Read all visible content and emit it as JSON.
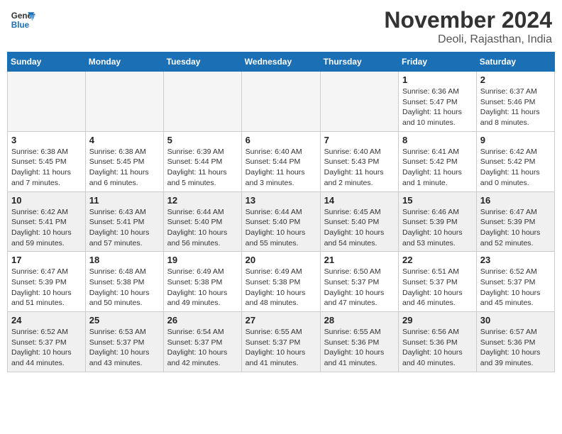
{
  "header": {
    "logo_line1": "General",
    "logo_line2": "Blue",
    "month": "November 2024",
    "location": "Deoli, Rajasthan, India"
  },
  "weekdays": [
    "Sunday",
    "Monday",
    "Tuesday",
    "Wednesday",
    "Thursday",
    "Friday",
    "Saturday"
  ],
  "weeks": [
    [
      {
        "day": "",
        "info": "",
        "empty": true
      },
      {
        "day": "",
        "info": "",
        "empty": true
      },
      {
        "day": "",
        "info": "",
        "empty": true
      },
      {
        "day": "",
        "info": "",
        "empty": true
      },
      {
        "day": "",
        "info": "",
        "empty": true
      },
      {
        "day": "1",
        "info": "Sunrise: 6:36 AM\nSunset: 5:47 PM\nDaylight: 11 hours and 10 minutes."
      },
      {
        "day": "2",
        "info": "Sunrise: 6:37 AM\nSunset: 5:46 PM\nDaylight: 11 hours and 8 minutes."
      }
    ],
    [
      {
        "day": "3",
        "info": "Sunrise: 6:38 AM\nSunset: 5:45 PM\nDaylight: 11 hours and 7 minutes."
      },
      {
        "day": "4",
        "info": "Sunrise: 6:38 AM\nSunset: 5:45 PM\nDaylight: 11 hours and 6 minutes."
      },
      {
        "day": "5",
        "info": "Sunrise: 6:39 AM\nSunset: 5:44 PM\nDaylight: 11 hours and 5 minutes."
      },
      {
        "day": "6",
        "info": "Sunrise: 6:40 AM\nSunset: 5:44 PM\nDaylight: 11 hours and 3 minutes."
      },
      {
        "day": "7",
        "info": "Sunrise: 6:40 AM\nSunset: 5:43 PM\nDaylight: 11 hours and 2 minutes."
      },
      {
        "day": "8",
        "info": "Sunrise: 6:41 AM\nSunset: 5:42 PM\nDaylight: 11 hours and 1 minute."
      },
      {
        "day": "9",
        "info": "Sunrise: 6:42 AM\nSunset: 5:42 PM\nDaylight: 11 hours and 0 minutes."
      }
    ],
    [
      {
        "day": "10",
        "info": "Sunrise: 6:42 AM\nSunset: 5:41 PM\nDaylight: 10 hours and 59 minutes.",
        "shaded": true
      },
      {
        "day": "11",
        "info": "Sunrise: 6:43 AM\nSunset: 5:41 PM\nDaylight: 10 hours and 57 minutes.",
        "shaded": true
      },
      {
        "day": "12",
        "info": "Sunrise: 6:44 AM\nSunset: 5:40 PM\nDaylight: 10 hours and 56 minutes.",
        "shaded": true
      },
      {
        "day": "13",
        "info": "Sunrise: 6:44 AM\nSunset: 5:40 PM\nDaylight: 10 hours and 55 minutes.",
        "shaded": true
      },
      {
        "day": "14",
        "info": "Sunrise: 6:45 AM\nSunset: 5:40 PM\nDaylight: 10 hours and 54 minutes.",
        "shaded": true
      },
      {
        "day": "15",
        "info": "Sunrise: 6:46 AM\nSunset: 5:39 PM\nDaylight: 10 hours and 53 minutes.",
        "shaded": true
      },
      {
        "day": "16",
        "info": "Sunrise: 6:47 AM\nSunset: 5:39 PM\nDaylight: 10 hours and 52 minutes.",
        "shaded": true
      }
    ],
    [
      {
        "day": "17",
        "info": "Sunrise: 6:47 AM\nSunset: 5:39 PM\nDaylight: 10 hours and 51 minutes."
      },
      {
        "day": "18",
        "info": "Sunrise: 6:48 AM\nSunset: 5:38 PM\nDaylight: 10 hours and 50 minutes."
      },
      {
        "day": "19",
        "info": "Sunrise: 6:49 AM\nSunset: 5:38 PM\nDaylight: 10 hours and 49 minutes."
      },
      {
        "day": "20",
        "info": "Sunrise: 6:49 AM\nSunset: 5:38 PM\nDaylight: 10 hours and 48 minutes."
      },
      {
        "day": "21",
        "info": "Sunrise: 6:50 AM\nSunset: 5:37 PM\nDaylight: 10 hours and 47 minutes."
      },
      {
        "day": "22",
        "info": "Sunrise: 6:51 AM\nSunset: 5:37 PM\nDaylight: 10 hours and 46 minutes."
      },
      {
        "day": "23",
        "info": "Sunrise: 6:52 AM\nSunset: 5:37 PM\nDaylight: 10 hours and 45 minutes."
      }
    ],
    [
      {
        "day": "24",
        "info": "Sunrise: 6:52 AM\nSunset: 5:37 PM\nDaylight: 10 hours and 44 minutes.",
        "shaded": true
      },
      {
        "day": "25",
        "info": "Sunrise: 6:53 AM\nSunset: 5:37 PM\nDaylight: 10 hours and 43 minutes.",
        "shaded": true
      },
      {
        "day": "26",
        "info": "Sunrise: 6:54 AM\nSunset: 5:37 PM\nDaylight: 10 hours and 42 minutes.",
        "shaded": true
      },
      {
        "day": "27",
        "info": "Sunrise: 6:55 AM\nSunset: 5:37 PM\nDaylight: 10 hours and 41 minutes.",
        "shaded": true
      },
      {
        "day": "28",
        "info": "Sunrise: 6:55 AM\nSunset: 5:36 PM\nDaylight: 10 hours and 41 minutes.",
        "shaded": true
      },
      {
        "day": "29",
        "info": "Sunrise: 6:56 AM\nSunset: 5:36 PM\nDaylight: 10 hours and 40 minutes.",
        "shaded": true
      },
      {
        "day": "30",
        "info": "Sunrise: 6:57 AM\nSunset: 5:36 PM\nDaylight: 10 hours and 39 minutes.",
        "shaded": true
      }
    ]
  ]
}
